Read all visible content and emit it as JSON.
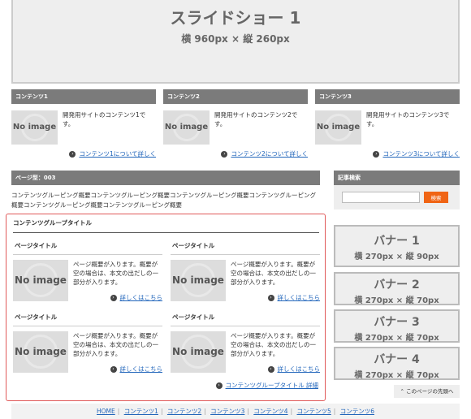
{
  "slideshow": {
    "title": "スライドショー 1",
    "size": "横 960px × 縦 260px"
  },
  "contents": [
    {
      "header": "コンテンツ1",
      "image": "No image",
      "description": "開発用サイトのコンテンツ1です。",
      "more": "コンテンツ1について詳しく"
    },
    {
      "header": "コンテンツ2",
      "image": "No image",
      "description": "開発用サイトのコンテンツ2です。",
      "more": "コンテンツ2について詳しく"
    },
    {
      "header": "コンテンツ3",
      "image": "No image",
      "description": "開発用サイトのコンテンツ3です。",
      "more": "コンテンツ3について詳しく"
    }
  ],
  "page_type": "ページ型：003",
  "page_description": "コンテンツグルーピング概要コンテンツグルーピング概要コンテンツグルーピング概要コンテンツグルーピング概要コンテンツグルーピング概要コンテンツグルーピング概要",
  "group": {
    "title": "コンテンツグループタイトル",
    "cards": [
      {
        "title": "ページタイトル",
        "image": "No image",
        "description": "ページ概要が入ります。概要が空の場合は、本文の出だしの一部分が入ります。",
        "more": "詳しくはこちら"
      },
      {
        "title": "ページタイトル",
        "image": "No image",
        "description": "ページ概要が入ります。概要が空の場合は、本文の出だしの一部分が入ります。",
        "more": "詳しくはこちら"
      },
      {
        "title": "ページタイトル",
        "image": "No image",
        "description": "ページ概要が入ります。概要が空の場合は、本文の出だしの一部分が入ります。",
        "more": "詳しくはこちら"
      },
      {
        "title": "ページタイトル",
        "image": "No image",
        "description": "ページ概要が入ります。概要が空の場合は、本文の出だしの一部分が入ります。",
        "more": "詳しくはこちら"
      }
    ],
    "more": "コンテンツグループタイトル 詳細"
  },
  "search": {
    "header": "記事検索",
    "placeholder": "",
    "button": "検索"
  },
  "banners": [
    {
      "title": "バナー 1",
      "size": "横 270px × 縦 90px"
    },
    {
      "title": "バナー 2",
      "size": "横 270px × 縦 70px"
    },
    {
      "title": "バナー 3",
      "size": "横 270px × 縦 70px"
    },
    {
      "title": "バナー 4",
      "size": "横 270px × 縦 70px"
    }
  ],
  "to_top": "このページの先頭へ",
  "footer_links": [
    "HOME",
    "コンテンツ1",
    "コンテンツ2",
    "コンテンツ3",
    "コンテンツ4",
    "コンテンツ5",
    "コンテンツ6"
  ],
  "colors": {
    "header_gray": "#7b7b7b",
    "search_button": "#f06414",
    "highlight_border": "#e05a5a",
    "link": "#2266bb"
  }
}
